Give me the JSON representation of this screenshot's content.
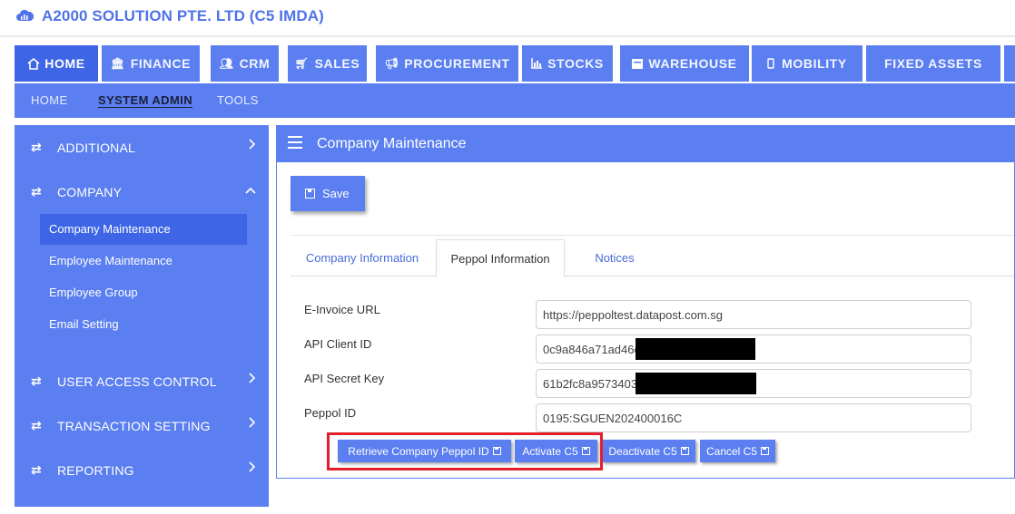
{
  "app": {
    "brand": "A2000 SOLUTION PTE. LTD (C5 IMDA)",
    "accent": "#5b7ff0",
    "accent_active": "#3d65e6",
    "highlight": "#e3202a"
  },
  "modules": [
    {
      "label": "HOME",
      "icon": "home-icon",
      "active": true
    },
    {
      "label": "FINANCE",
      "icon": "bank-icon"
    },
    {
      "label": "CRM",
      "icon": "users-icon"
    },
    {
      "label": "SALES",
      "icon": "cart-icon"
    },
    {
      "label": "PROCUREMENT",
      "icon": "megaphone-icon"
    },
    {
      "label": "STOCKS",
      "icon": "bar-chart-icon"
    },
    {
      "label": "WAREHOUSE",
      "icon": "building-icon"
    },
    {
      "label": "MOBILITY",
      "icon": "mobile-icon"
    },
    {
      "label": "FIXED ASSETS",
      "icon": ""
    }
  ],
  "subnav": [
    {
      "label": "HOME"
    },
    {
      "label": "SYSTEM ADMIN",
      "active": true
    },
    {
      "label": "TOOLS"
    }
  ],
  "sidebar": {
    "sections": [
      {
        "label": "ADDITIONAL",
        "chevron": "right"
      },
      {
        "label": "COMPANY",
        "chevron": "up"
      },
      {
        "label": "USER ACCESS CONTROL",
        "chevron": "right"
      },
      {
        "label": "TRANSACTION SETTING",
        "chevron": "right"
      },
      {
        "label": "REPORTING",
        "chevron": "right"
      }
    ],
    "company_items": [
      {
        "label": "Company Maintenance",
        "active": true
      },
      {
        "label": "Employee Maintenance"
      },
      {
        "label": "Employee Group"
      },
      {
        "label": "Email Setting"
      }
    ]
  },
  "panel": {
    "title": "Company Maintenance",
    "save_label": "Save",
    "tabs": [
      {
        "label": "Company Information"
      },
      {
        "label": "Peppol Information",
        "active": true
      },
      {
        "label": "Notices"
      }
    ],
    "fields": [
      {
        "label": "E-Invoice URL",
        "value": "https://peppoltest.datapost.com.sg"
      },
      {
        "label": "API Client ID",
        "value": "0c9a846a71ad46c"
      },
      {
        "label": "API Secret Key",
        "value": "61b2fc8a9573403"
      },
      {
        "label": "Peppol ID",
        "value": "0195:SGUEN202400016C"
      }
    ],
    "actions": [
      {
        "label": "Retrieve Company Peppol ID"
      },
      {
        "label": "Activate C5"
      },
      {
        "label": "Deactivate C5"
      },
      {
        "label": "Cancel C5"
      }
    ]
  }
}
